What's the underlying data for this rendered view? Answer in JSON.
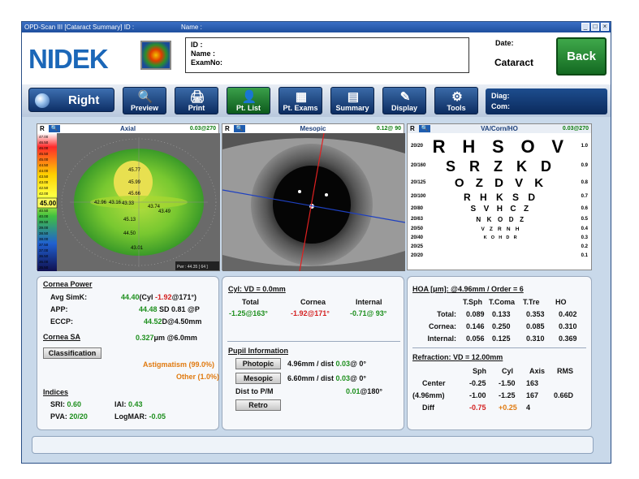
{
  "window": {
    "title": "OPD-Scan III [Cataract Summary] ID :",
    "name_label": "Name :"
  },
  "patient": {
    "id_label": "ID :",
    "name_label": "Name :",
    "exam_label": "ExamNo:"
  },
  "header": {
    "logo": "NIDEK",
    "date_label": "Date:",
    "mode": "Cataract",
    "back_label": "Back"
  },
  "toolbar": {
    "eye": "Right",
    "buttons": [
      "Preview",
      "Print",
      "Pt. List",
      "Pt. Exams",
      "Summary",
      "Display",
      "Tools"
    ],
    "diag_label": "Diag:",
    "com_label": "Com:"
  },
  "images": {
    "axial": {
      "eye": "R",
      "title": "Axial",
      "value": "0.03@270",
      "scale": [
        "47.00",
        "46.50",
        "46.00",
        "45.50",
        "45.00",
        "44.50",
        "44.00",
        "43.50",
        "43.00",
        "42.50",
        "42.00",
        "41.50",
        "41.00",
        "40.50",
        "40.00",
        "39.50",
        "39.00",
        "38.50",
        "38.00",
        "37.50",
        "37.00",
        "36.50",
        "36.00",
        "35.50"
      ],
      "scale_current": "45.00",
      "labels": [
        "45.77",
        "45.99",
        "45.66",
        "42.96",
        "43.16",
        "43.33",
        "43.74",
        "43.49",
        "45.13",
        "44.50",
        "43.01"
      ],
      "footer": "Pwr : 44.35 [ 64 ]"
    },
    "mesopic": {
      "eye": "R",
      "title": "Mesopic",
      "value": "0.12@ 90"
    },
    "chart": {
      "eye": "R",
      "title": "VA/Corn/HO",
      "value": "0.03@270",
      "rows": [
        {
          "acuity": "20/20",
          "letters": "R H S O V",
          "decimal": "1.0"
        },
        {
          "acuity": "20/160",
          "letters": "S R Z K D",
          "decimal": "0.9"
        },
        {
          "acuity": "20/125",
          "letters": "O Z D V K",
          "decimal": "0.8"
        },
        {
          "acuity": "20/100",
          "letters": "R H K S D",
          "decimal": "0.7"
        },
        {
          "acuity": "20/80",
          "letters": "S V H C Z",
          "decimal": "0.6"
        },
        {
          "acuity": "20/63",
          "letters": "N K O D Z",
          "decimal": "0.5"
        },
        {
          "acuity": "20/50",
          "letters": "V Z R N H",
          "decimal": "0.4"
        },
        {
          "acuity": "20/40",
          "letters": "K O H D R",
          "decimal": "0.3"
        },
        {
          "acuity": "20/25",
          "letters": "",
          "decimal": "0.2"
        },
        {
          "acuity": "20/20",
          "letters": "",
          "decimal": "0.1"
        }
      ]
    }
  },
  "cornea": {
    "power_title": "Cornea Power",
    "avg_simk_label": "Avg SimK:",
    "avg_simk_val": "44.40",
    "avg_simk_cyl_prefix": "(Cyl ",
    "avg_simk_cyl": "-1.92",
    "avg_simk_axis": "@171°)",
    "app_label": "APP:",
    "app_val": "44.48",
    "app_sd": " SD 0.81 @P",
    "eccp_label": "ECCP:",
    "eccp_val": "44.52",
    "eccp_suffix": "D@4.50mm",
    "sa_title": "Cornea SA",
    "sa_val": "0.327",
    "sa_suffix": "μm @6.0mm",
    "class_label": "Classification",
    "class1": "Astigmatism (99.0%)",
    "class2": "Other (1.0%)",
    "indices_title": "Indices",
    "sri_label": "SRI:",
    "sri_val": "0.60",
    "iai_label": "IAI:",
    "iai_val": "0.43",
    "pva_label": "PVA:",
    "pva_val": "20/20",
    "logmar_label": "LogMAR:",
    "logmar_val": "-0.05"
  },
  "cyl": {
    "title": "Cyl: VD = 0.0mm",
    "headers": [
      "Total",
      "Cornea",
      "Internal"
    ],
    "values": [
      "-1.25@163°",
      "-1.92@171°",
      "-0.71@ 93°"
    ]
  },
  "pupil": {
    "title": "Pupil Information",
    "photopic_label": "Photopic",
    "photopic_val": "4.96mm / dist ",
    "photopic_dist": "0.03",
    "photopic_axis": "@  0°",
    "mesopic_label": "Mesopic",
    "mesopic_val": "6.60mm / dist ",
    "mesopic_dist": "0.03",
    "mesopic_axis": "@  0°",
    "dist_label": "Dist to P/M",
    "dist_val": "0.01",
    "dist_axis": "@180°",
    "retro_label": "Retro"
  },
  "hoa": {
    "title": "HOA [μm]: @4.96mm / Order = 6",
    "headers": [
      "T.Sph",
      "T.Coma",
      "T.Tre",
      "HO"
    ],
    "rows": [
      {
        "label": "Total:",
        "vals": [
          "0.089",
          "0.133",
          "0.353",
          "0.402"
        ]
      },
      {
        "label": "Cornea:",
        "vals": [
          "0.146",
          "0.250",
          "0.085",
          "0.310"
        ]
      },
      {
        "label": "Internal:",
        "vals": [
          "0.056",
          "0.125",
          "0.310",
          "0.369"
        ]
      }
    ]
  },
  "refraction": {
    "title": "Refraction: VD = 12.00mm",
    "headers": [
      "Sph",
      "Cyl",
      "Axis",
      "RMS"
    ],
    "rows": [
      {
        "label": "Center",
        "vals": [
          "-0.25",
          "-1.50",
          "163",
          ""
        ]
      },
      {
        "label": "(4.96mm)",
        "vals": [
          "-1.00",
          "-1.25",
          "167",
          "0.66D"
        ]
      },
      {
        "label": "Diff",
        "vals": [
          "-0.75",
          "+0.25",
          "4",
          ""
        ]
      }
    ]
  }
}
